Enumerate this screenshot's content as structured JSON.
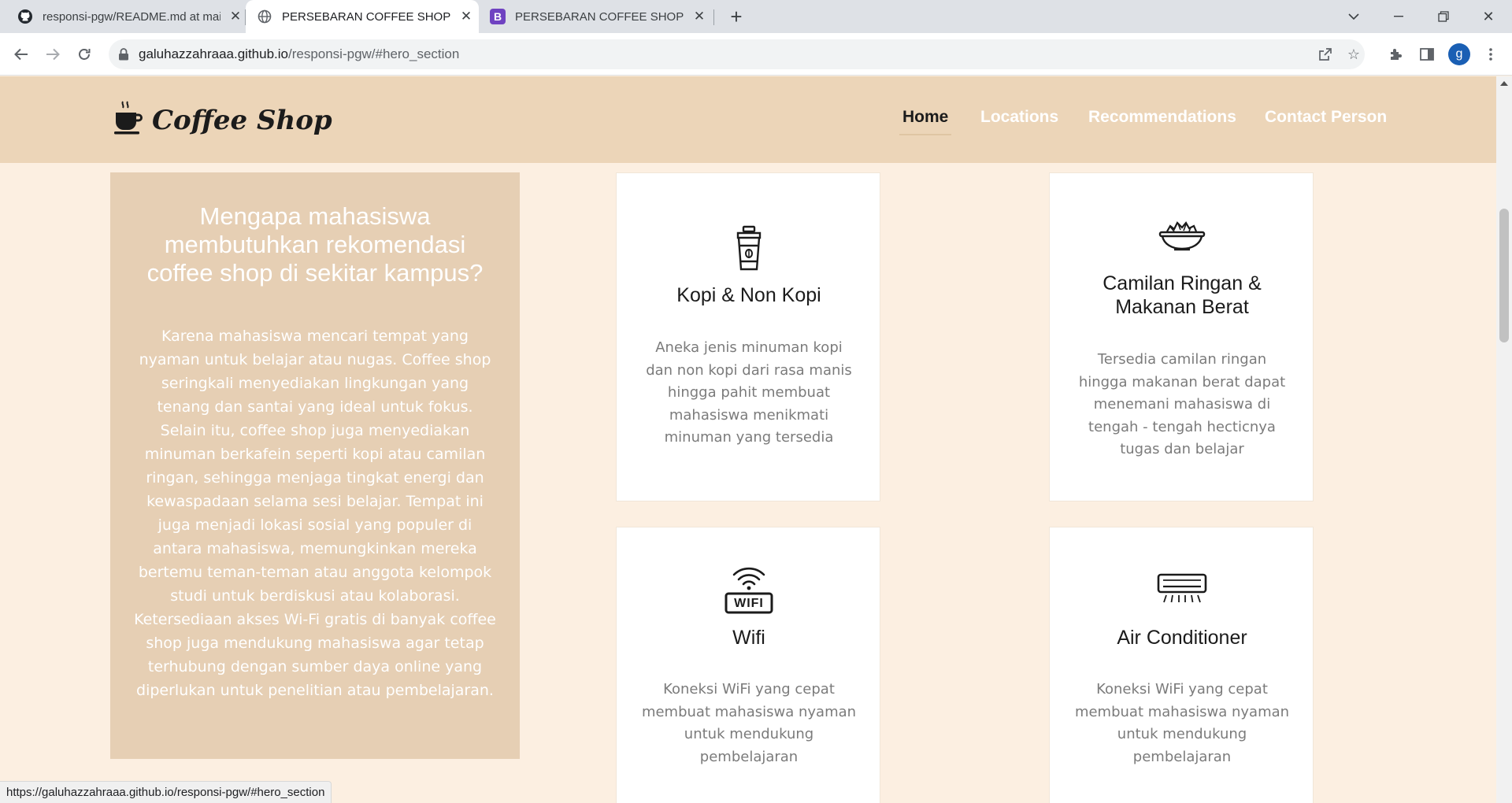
{
  "tabs": [
    {
      "title": "responsi-pgw/README.md at main",
      "favicon": "github-icon"
    },
    {
      "title": "PERSEBARAN COFFEE SHOP DI SEKITAR KAMPUS",
      "favicon": "globe-icon"
    },
    {
      "title": "PERSEBARAN COFFEE SHOP DI SEKITAR KAMPUS",
      "favicon": "bootstrap-icon"
    }
  ],
  "address": {
    "host": "galuhazzahraaa.github.io",
    "path": "/responsi-pgw/#hero_section"
  },
  "status_url": "https://galuhazzahraaa.github.io/responsi-pgw/#hero_section",
  "profile_initial": "g",
  "site": {
    "brand": "Coffee Shop",
    "nav": [
      "Home",
      "Locations",
      "Recommendations",
      "Contact Person"
    ],
    "active_nav": "Home"
  },
  "hero": {
    "title": "Mengapa mahasiswa membutuhkan rekomendasi coffee shop di sekitar kampus?",
    "text": "Karena mahasiswa mencari tempat yang nyaman untuk belajar atau nugas. Coffee shop seringkali menyediakan lingkungan yang tenang dan santai yang ideal untuk fokus. Selain itu, coffee shop juga menyediakan minuman berkafein seperti kopi atau camilan ringan, sehingga menjaga tingkat energi dan kewaspadaan selama sesi belajar. Tempat ini juga menjadi lokasi sosial yang populer di antara mahasiswa, memungkinkan mereka bertemu teman-teman atau anggota kelompok studi untuk berdiskusi atau kolaborasi. Ketersediaan akses Wi-Fi gratis di banyak coffee shop juga mendukung mahasiswa agar tetap terhubung dengan sumber daya online yang diperlukan untuk penelitian atau pembelajaran."
  },
  "features": [
    {
      "icon": "coffee-cup-icon",
      "title": "Kopi & Non Kopi",
      "text": "Aneka jenis minuman kopi dan non kopi dari rasa manis hingga pahit membuat mahasiswa menikmati minuman yang tersedia"
    },
    {
      "icon": "snack-bowl-icon",
      "title": "Camilan Ringan & Makanan Berat",
      "text": "Tersedia camilan ringan hingga makanan berat dapat menemani mahasiswa di tengah - tengah hecticnya tugas dan belajar"
    },
    {
      "icon": "wifi-icon",
      "title": "Wifi",
      "text": "Koneksi WiFi yang cepat membuat mahasiswa nyaman untuk mendukung pembelajaran"
    },
    {
      "icon": "air-conditioner-icon",
      "title": "Air Conditioner",
      "text": "Koneksi WiFi yang cepat membuat mahasiswa nyaman untuk mendukung pembelajaran"
    }
  ],
  "wifi_label": "WIFI"
}
